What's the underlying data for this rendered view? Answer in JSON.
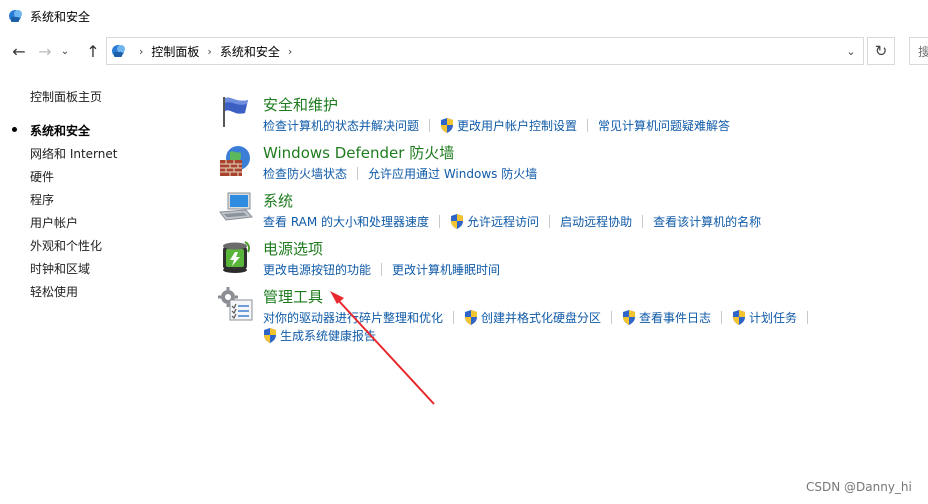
{
  "window": {
    "title": "系统和安全"
  },
  "nav": {
    "back_icon": "arrow-left-icon",
    "forward_icon": "arrow-right-icon",
    "recent_icon": "chevron-down-icon",
    "up_icon": "arrow-up-icon",
    "breadcrumb": [
      "控制面板",
      "系统和安全"
    ],
    "refresh_icon": "refresh-icon",
    "search_placeholder": "搜"
  },
  "sidebar": {
    "home": "控制面板主页",
    "items": [
      {
        "label": "系统和安全",
        "current": true
      },
      {
        "label": "网络和 Internet",
        "current": false
      },
      {
        "label": "硬件",
        "current": false
      },
      {
        "label": "程序",
        "current": false
      },
      {
        "label": "用户帐户",
        "current": false
      },
      {
        "label": "外观和个性化",
        "current": false
      },
      {
        "label": "时钟和区域",
        "current": false
      },
      {
        "label": "轻松使用",
        "current": false
      }
    ]
  },
  "categories": [
    {
      "title": "安全和维护",
      "icon": "flag-icon",
      "links": [
        {
          "label": "检查计算机的状态并解决问题",
          "shield": false
        },
        {
          "label": "更改用户帐户控制设置",
          "shield": true
        },
        {
          "label": "常见计算机问题疑难解答",
          "shield": false
        }
      ]
    },
    {
      "title": "Windows Defender 防火墙",
      "icon": "firewall-icon",
      "links": [
        {
          "label": "检查防火墙状态",
          "shield": false
        },
        {
          "label": "允许应用通过 Windows 防火墙",
          "shield": false
        }
      ]
    },
    {
      "title": "系统",
      "icon": "computer-icon",
      "links": [
        {
          "label": "查看 RAM 的大小和处理器速度",
          "shield": false
        },
        {
          "label": "允许远程访问",
          "shield": true
        },
        {
          "label": "启动远程协助",
          "shield": false
        },
        {
          "label": "查看该计算机的名称",
          "shield": false
        }
      ]
    },
    {
      "title": "电源选项",
      "icon": "battery-icon",
      "links": [
        {
          "label": "更改电源按钮的功能",
          "shield": false
        },
        {
          "label": "更改计算机睡眠时间",
          "shield": false
        }
      ]
    },
    {
      "title": "管理工具",
      "icon": "admin-tools-icon",
      "links": [
        {
          "label": "对你的驱动器进行碎片整理和优化",
          "shield": false
        },
        {
          "label": "创建并格式化硬盘分区",
          "shield": true
        },
        {
          "label": "查看事件日志",
          "shield": true
        },
        {
          "label": "计划任务",
          "shield": true
        }
      ],
      "links_row2": [
        {
          "label": "生成系统健康报告",
          "shield": true
        }
      ]
    }
  ],
  "colors": {
    "category_title": "#1e7c1e",
    "link": "#0f5aa8",
    "annotation": "#e8282d"
  },
  "watermark": "CSDN @Danny_hi"
}
